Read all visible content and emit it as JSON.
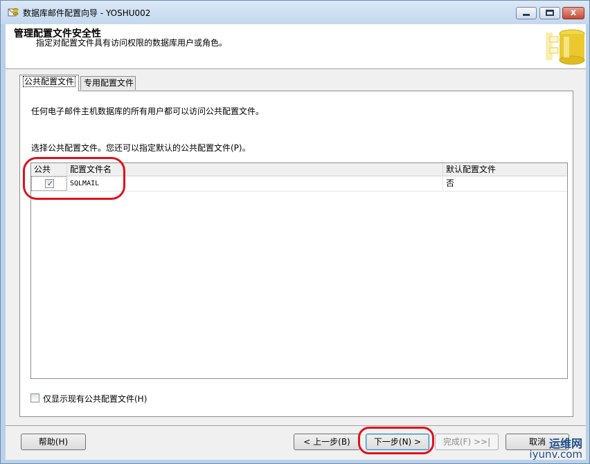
{
  "window": {
    "title": "数据库邮件配置向导 - YOSHU002",
    "min_glyph": "",
    "close_glyph": "x"
  },
  "header": {
    "title": "管理配置文件安全性",
    "subtitle": "指定对配置文件具有访问权限的数据库用户或角色。"
  },
  "tabs": [
    {
      "label": "公共配置文件",
      "active": true
    },
    {
      "label": "专用配置文件",
      "active": false
    }
  ],
  "panel": {
    "description": "任何电子邮件主机数据库的所有用户都可以访问公共配置文件。",
    "instruction": "选择公共配置文件。您还可以指定默认的公共配置文件(P)。"
  },
  "grid": {
    "columns": [
      "公共",
      "配置文件名",
      "默认配置文件"
    ],
    "rows": [
      {
        "public": true,
        "public_mark": "✓",
        "name": "SQLMAIL",
        "default": "否"
      }
    ]
  },
  "option": {
    "label": "仅显示现有公共配置文件(H)",
    "checked": false
  },
  "buttons": {
    "help": "帮助(H)",
    "back": "< 上一步(B)",
    "next": "下一步(N) >",
    "finish": "完成(F) >>|",
    "cancel": "取消"
  },
  "watermark": {
    "line1": "运维网",
    "line2": "iyunv.com"
  },
  "colors": {
    "annotation": "#e0101a",
    "titlebar": "#c3d7ee"
  }
}
